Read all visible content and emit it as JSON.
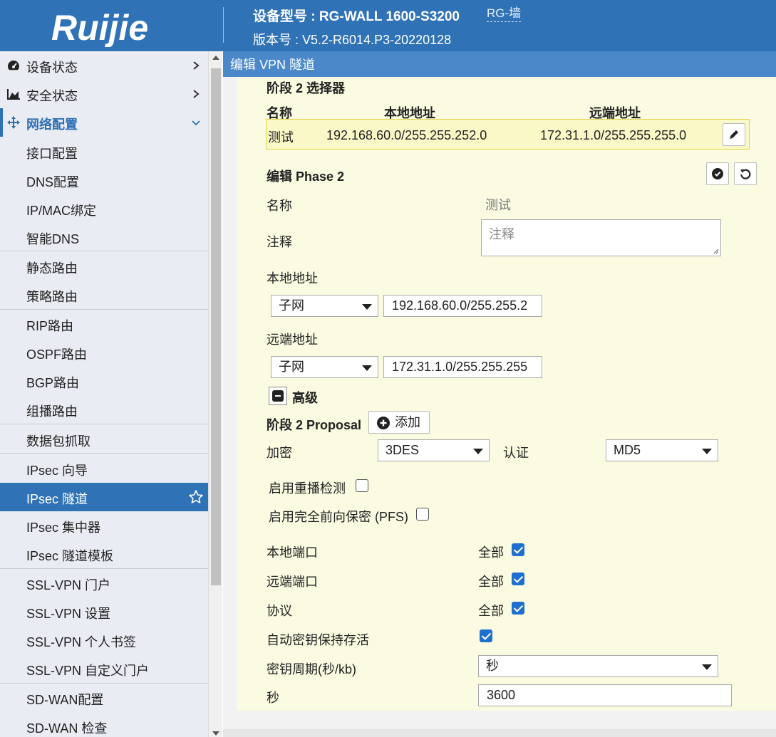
{
  "header": {
    "brand": "Ruijie",
    "device": "设备型号 : RG-WALL 1600-S3200",
    "tag": "RG-墙",
    "version": "版本号 : V5.2-R6014.P3-20220128"
  },
  "sidebar": {
    "items": [
      {
        "label": "设备状态",
        "icon": "dashboard-icon"
      },
      {
        "label": "安全状态",
        "icon": "area-chart-icon"
      },
      {
        "label": "网络配置",
        "icon": "move-arrows-icon"
      },
      {
        "label": "接口配置"
      },
      {
        "label": "DNS配置"
      },
      {
        "label": "IP/MAC绑定"
      },
      {
        "label": "智能DNS"
      },
      {
        "label": "静态路由"
      },
      {
        "label": "策略路由"
      },
      {
        "label": "RIP路由"
      },
      {
        "label": "OSPF路由"
      },
      {
        "label": "BGP路由"
      },
      {
        "label": "组播路由"
      },
      {
        "label": "数据包抓取"
      },
      {
        "label": "IPsec 向导"
      },
      {
        "label": "IPsec 隧道"
      },
      {
        "label": "IPsec 集中器"
      },
      {
        "label": "IPsec 隧道模板"
      },
      {
        "label": "SSL-VPN 门户"
      },
      {
        "label": "SSL-VPN 设置"
      },
      {
        "label": "SSL-VPN 个人书签"
      },
      {
        "label": "SSL-VPN 自定义门户"
      },
      {
        "label": "SD-WAN配置"
      },
      {
        "label": "SD-WAN 检查"
      }
    ],
    "active_color": "#2f72b6"
  },
  "content": {
    "title": "编辑 VPN 隧道",
    "selector_section": "阶段 2 选择器",
    "columns": {
      "name": "名称",
      "local": "本地地址",
      "remote": "远端地址"
    },
    "selector_row": {
      "name": "测试",
      "local": "192.168.60.0/255.255.252.0",
      "remote": "172.31.1.0/255.255.255.0"
    },
    "edit_title": "编辑 Phase 2",
    "labels": {
      "name": "名称",
      "comment": "注释",
      "local_addr": "本地地址",
      "remote_addr": "远端地址",
      "advanced": "高级",
      "proposal": "阶段 2 Proposal",
      "add": "添加",
      "encryption": "加密",
      "auth": "认证",
      "replay": "启用重播检测",
      "pfs": "启用完全前向保密 (PFS)",
      "local_port": "本地端口",
      "remote_port": "远端端口",
      "protocol": "协议",
      "keepalive": "自动密钥保持存活",
      "key_lifetime": "密钥周期(秒/kb)",
      "seconds": "秒",
      "all": "全部"
    },
    "values": {
      "name": "测试",
      "comment_placeholder": "注释",
      "local_type": "子网",
      "local_value": "192.168.60.0/255.255.2",
      "remote_type": "子网",
      "remote_value": "172.31.1.0/255.255.255",
      "encryption": "3DES",
      "auth": "MD5",
      "key_lifetime_unit": "秒",
      "seconds": "3600"
    }
  }
}
